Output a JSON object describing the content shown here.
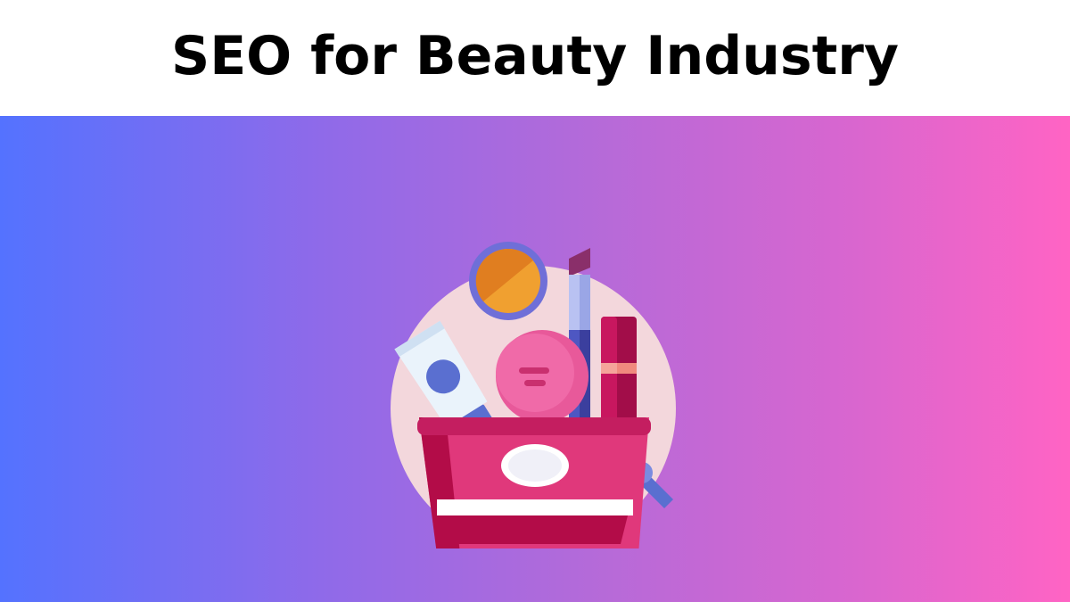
{
  "header": {
    "title": "SEO for Beauty Industry"
  },
  "banner": {
    "gradient_start": "#5472ff",
    "gradient_end": "#ff64c4",
    "illustration": "makeup-bag-icon"
  },
  "colors": {
    "circle_bg": "#f3d7dc",
    "bag": "#e0387b",
    "bag_dark": "#b30c48",
    "compact_orange": "#f0a030",
    "compact_ring": "#6f6fd8",
    "tube": "#eaf3fb",
    "tube_cap": "#5a6fd0",
    "puff": "#e8599a",
    "lipstick": "#c0105a"
  }
}
